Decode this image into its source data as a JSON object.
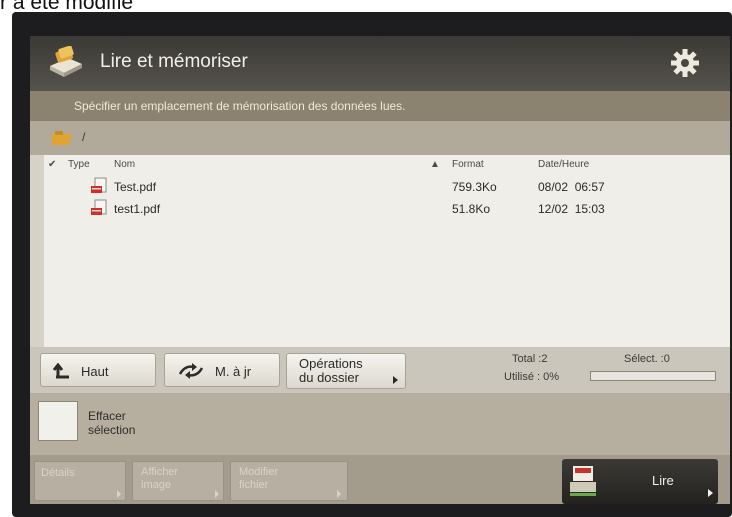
{
  "caption": "r a été modifié",
  "header": {
    "title": "Lire et mémoriser",
    "icon": "scan-store-icon",
    "settings_icon": "gear-icon"
  },
  "instruction": "Spécifier un emplacement de mémorisation des données lues.",
  "path": {
    "icon": "folder-icon",
    "text": "/"
  },
  "table": {
    "columns": {
      "check": "✔",
      "type": "Type",
      "name": "Nom",
      "sort_indicator": "▲",
      "format": "Format",
      "date": "Date/Heure"
    },
    "rows": [
      {
        "type_icon": "pdf-icon",
        "name": "Test.pdf",
        "format": "759.3Ko",
        "date": "08/02  06:57"
      },
      {
        "type_icon": "pdf-icon",
        "name": "test1.pdf",
        "format": "51.8Ko",
        "date": "12/02  15:03"
      }
    ]
  },
  "toolbar": {
    "up_label": "Haut",
    "refresh_label": "M. à jr",
    "folder_ops_line1": "Opérations",
    "folder_ops_line2": "du dossier"
  },
  "status": {
    "total": "Total :2",
    "select": "Sélect. :0",
    "used": "Utilisé : 0%",
    "used_fraction": 0.0
  },
  "clear": {
    "line1": "Effacer",
    "line2": "sélection"
  },
  "bottom": {
    "details": "Détails",
    "show_image_line1": "Afficher",
    "show_image_line2": "image",
    "edit_file_line1": "Modifier",
    "edit_file_line2": "fichier",
    "read_label": "Lire"
  },
  "colors": {
    "titlebar": "#3b3935",
    "instruction_bar": "#8b826f",
    "list_bg": "#efeee9",
    "pdf_red": "#c8322a"
  }
}
